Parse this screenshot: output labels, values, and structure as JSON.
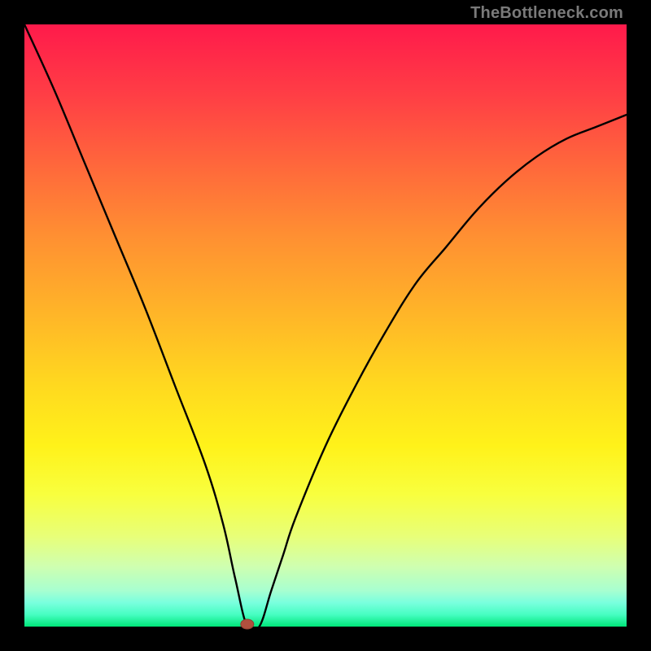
{
  "watermark": "TheBottleneck.com",
  "colors": {
    "frame": "#000000",
    "gradient_top": "#ff1a4b",
    "gradient_mid": "#ffd91f",
    "gradient_bottom": "#00e67a",
    "curve": "#000000",
    "min_marker": "#b0503e"
  },
  "chart_data": {
    "type": "line",
    "title": "",
    "xlabel": "",
    "ylabel": "",
    "xlim": [
      0,
      100
    ],
    "ylim": [
      0,
      100
    ],
    "grid": false,
    "legend": false,
    "annotations": [
      {
        "name": "min-marker",
        "x": 37,
        "y": 0
      }
    ],
    "series": [
      {
        "name": "bottleneck-curve",
        "x": [
          0,
          5,
          10,
          15,
          20,
          25,
          30,
          33,
          35,
          37,
          39,
          41,
          43,
          45,
          50,
          55,
          60,
          65,
          70,
          75,
          80,
          85,
          90,
          95,
          100
        ],
        "values": [
          100,
          89,
          77,
          65,
          53,
          40,
          27,
          17,
          8,
          0,
          0,
          6,
          12,
          18,
          30,
          40,
          49,
          57,
          63,
          69,
          74,
          78,
          81,
          83,
          85
        ]
      }
    ]
  }
}
